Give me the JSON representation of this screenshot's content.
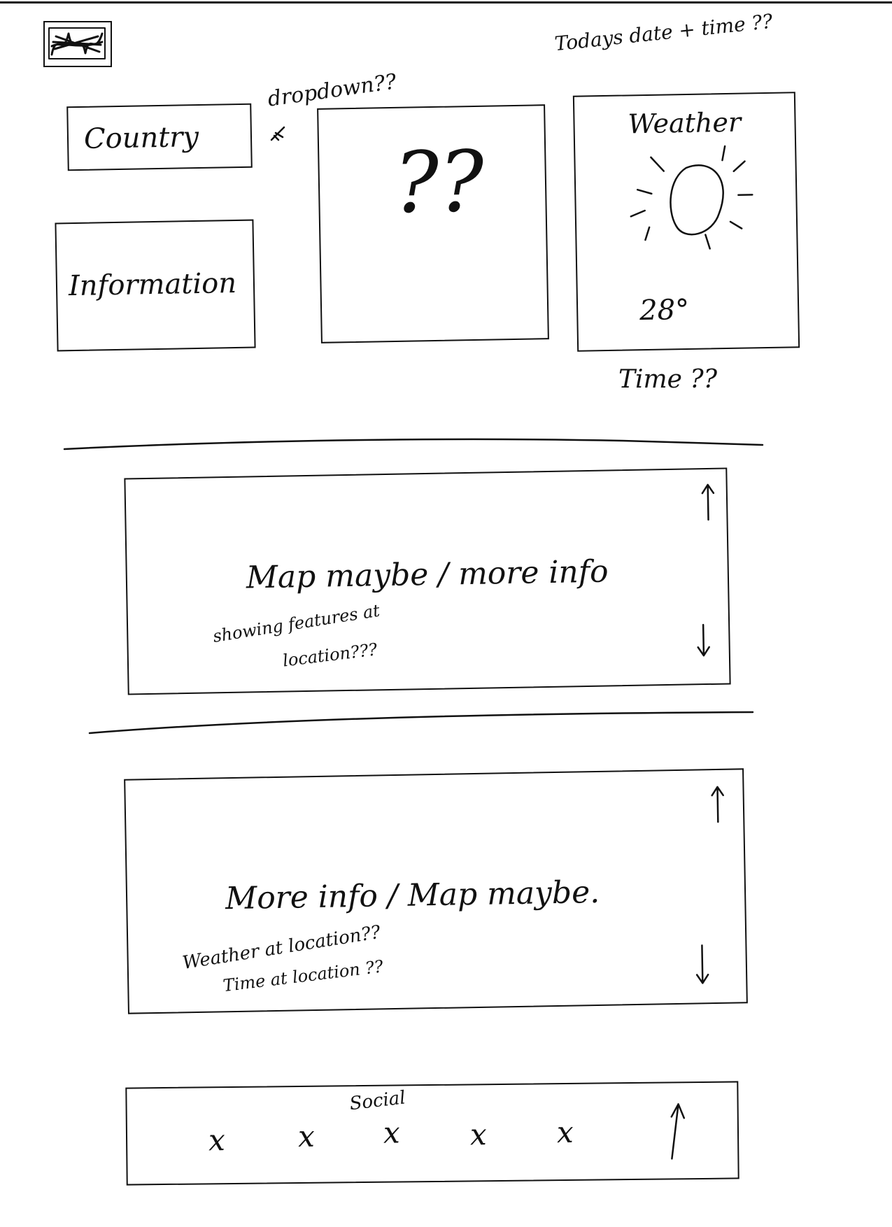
{
  "header": {
    "logo_label": "",
    "date_time_note": "Todays date + time ??"
  },
  "top": {
    "country_label": "Country",
    "dropdown_note": "dropdown??",
    "information_label": "Information",
    "mystery_label": "??",
    "weather": {
      "title": "Weather",
      "temperature": "28°",
      "icon": "sun-icon"
    },
    "time_note": "Time ??"
  },
  "section1": {
    "main_text": "Map maybe / more info",
    "note_line1": "showing features at",
    "note_line2": "location???"
  },
  "section2": {
    "main_text": "More info / Map maybe.",
    "note_line1": "Weather at location??",
    "note_line2": "Time at location ??"
  },
  "social": {
    "title": "Social",
    "icons": [
      "x",
      "x",
      "x",
      "x",
      "x"
    ],
    "top_arrow": "back-to-top-arrow-icon"
  },
  "colors": {
    "ink": "#111111",
    "paper": "#ffffff"
  }
}
